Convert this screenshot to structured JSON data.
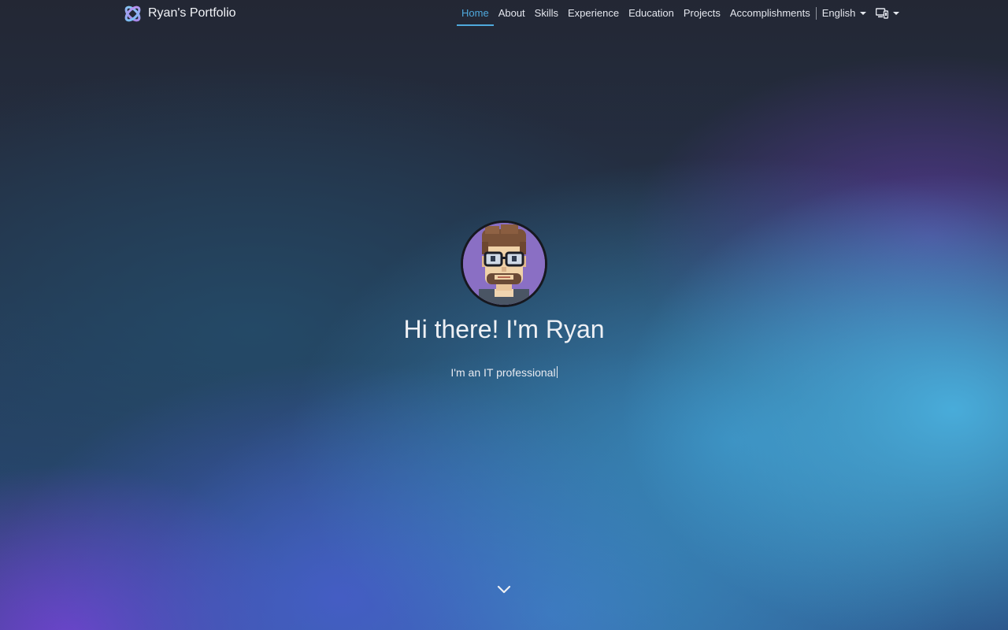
{
  "brand": {
    "name": "Ryan's Portfolio",
    "logo_icon": "portfolio-logo-icon"
  },
  "nav": {
    "items": [
      {
        "label": "Home",
        "active": true
      },
      {
        "label": "About"
      },
      {
        "label": "Skills"
      },
      {
        "label": "Experience"
      },
      {
        "label": "Education"
      },
      {
        "label": "Projects"
      },
      {
        "label": "Accomplishments"
      }
    ],
    "language": {
      "selected": "English"
    },
    "theme": {
      "icon": "device-theme-icon"
    }
  },
  "hero": {
    "avatar_icon": "pixel-avatar",
    "title": "Hi there! I'm Ryan",
    "subtitle": "I'm an IT professional"
  },
  "scroll": {
    "icon": "chevron-down-icon"
  },
  "colors": {
    "accent": "#4fa9dd",
    "text": "#eef0f4"
  }
}
